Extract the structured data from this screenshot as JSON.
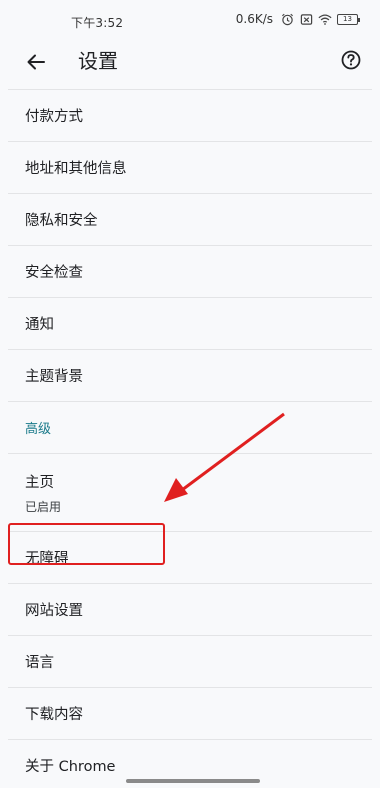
{
  "status_bar": {
    "time": "下午3:52",
    "speed": "0.6K/s",
    "battery": "13"
  },
  "toolbar": {
    "title": "设置"
  },
  "settings": {
    "payment": "付款方式",
    "addresses": "地址和其他信息",
    "privacy": "隐私和安全",
    "safety_check": "安全检查",
    "notifications": "通知",
    "themes": "主题背景",
    "advanced_header": "高级",
    "homepage": "主页",
    "homepage_status": "已启用",
    "accessibility": "无障碍",
    "site_settings": "网站设置",
    "languages": "语言",
    "downloads": "下载内容",
    "about": "关于 Chrome"
  },
  "colors": {
    "accent_teal": "#1a7a8a",
    "annotation_red": "#e02020"
  }
}
